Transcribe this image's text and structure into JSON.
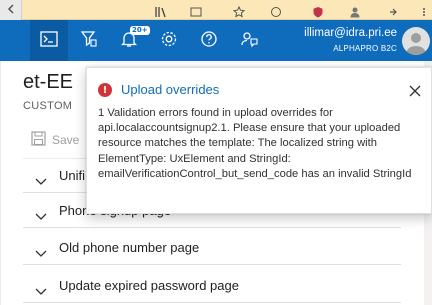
{
  "header": {
    "notification_count": "20+",
    "user_email": "illimar@idra.pri.ee",
    "tenant_name": "ALPHAPRO B2C"
  },
  "blade": {
    "title": "et-EE",
    "subtitle": "CUSTOM",
    "save_label": "Save"
  },
  "accordion": {
    "items": [
      {
        "label": "Unifi"
      },
      {
        "label": "Phone signup page"
      },
      {
        "label": "Old phone number page"
      },
      {
        "label": "Update expired password page"
      }
    ]
  },
  "toast": {
    "title": "Upload overrides",
    "message": "1 Validation errors found in upload overrides for api.localaccountsignup2.1. Please ensure that your uploaded resource matches the template: The localized string with ElementType: UxElement and StringId: emailVerificationControl_but_send_code has an invalid StringId"
  },
  "colors": {
    "header_bg": "#0f6cbd",
    "error_red": "#d13438",
    "link_blue": "#0f6cbd"
  }
}
